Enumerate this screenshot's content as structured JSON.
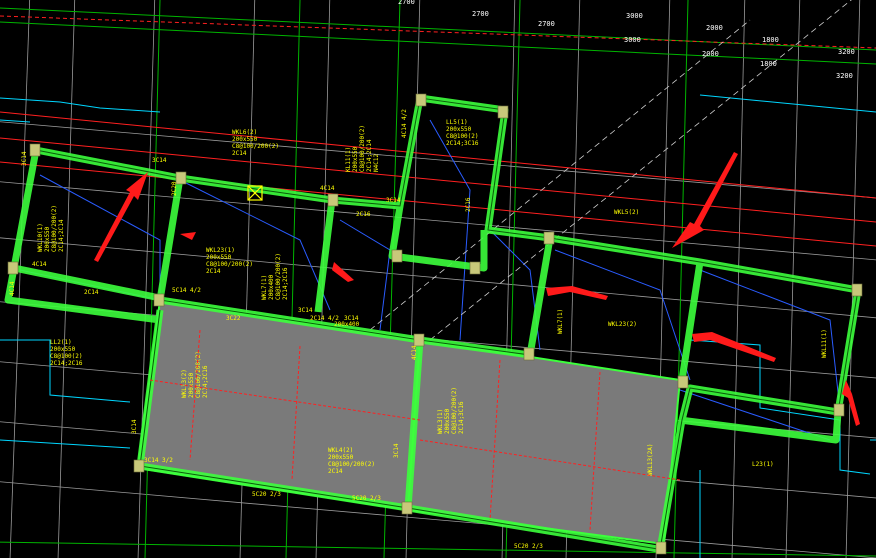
{
  "colors": {
    "background": "#000000",
    "beam_outline": "#3cff3c",
    "beam_fill": "#5fe35f",
    "column": "#c8c87a",
    "slab_fill": "#7a7a7a",
    "grid_white": "#d0d0d0",
    "grid_green": "#00b000",
    "axis_red": "#ff2020",
    "cyan": "#00d6ff",
    "blue": "#2060ff",
    "text_yellow": "#ffff00",
    "arrow_red": "#ff1a1a"
  },
  "dimensions": {
    "top_row_1": [
      "2700",
      "2700",
      "3000",
      "2000",
      "1800",
      "3200"
    ],
    "top_row_2": [
      "2700",
      "3000",
      "2000",
      "1800",
      "3200"
    ]
  },
  "beam_labels": [
    {
      "id": "wkl6",
      "lines": [
        "WKL6(2)",
        "200x550",
        "C8@100/200(2)",
        "2C14"
      ]
    },
    {
      "id": "ll5",
      "lines": [
        "LL5(1)",
        "200x550",
        "C8@100(2)",
        "2C14;3C16"
      ]
    },
    {
      "id": "wkl10",
      "lines": [
        "WKL10(1)",
        "200x550",
        "C8@100/200(2)",
        "2C14;2C14"
      ]
    },
    {
      "id": "wkl23",
      "lines": [
        "WKL23(1)",
        "200x550",
        "C8@100/200(2)",
        "2C14"
      ]
    },
    {
      "id": "wkl7",
      "lines": [
        "WKL7(1)",
        "200x400",
        "C8@100/200(2)",
        "2C14;2C16"
      ]
    },
    {
      "id": "kl11",
      "lines": [
        "KL11(1)",
        "200x550",
        "C8@100/200(2)",
        "2C14;2C14",
        "N4C12"
      ]
    },
    {
      "id": "wkl13",
      "lines": [
        "WKL13(2)",
        "200x550",
        "C8@100/200(2)",
        "2C14;2C16"
      ]
    },
    {
      "id": "wkl3",
      "lines": [
        "WKL3(1)",
        "200x550",
        "C8@100/200(2)",
        "2C14;3C16"
      ]
    },
    {
      "id": "wkl4",
      "lines": [
        "WKL4(2)",
        "200x550",
        "C8@100/200(2)",
        "2C14"
      ]
    },
    {
      "id": "ll2",
      "lines": [
        "LL2(1)",
        "200x550",
        "C8@100(2)",
        "2C14;2C16"
      ]
    },
    {
      "id": "wkl23b",
      "lines": [
        "WKL23(2)"
      ]
    },
    {
      "id": "wkl11",
      "lines": [
        "WKL11(1)"
      ]
    },
    {
      "id": "wkl13b",
      "lines": [
        "WKL13(2A)"
      ]
    },
    {
      "id": "wkl7b",
      "lines": [
        "WKL7(1)"
      ]
    },
    {
      "id": "wkl5",
      "lines": [
        "WKL5(2)"
      ]
    },
    {
      "id": "l23",
      "lines": [
        "L23(1)"
      ]
    }
  ],
  "small_labels": {
    "c14_a": "3C14",
    "c14_b": "4C14",
    "c14_c": "3C14",
    "c14_d": "2C16",
    "c14_e": "3C14",
    "c14_f": "4C14",
    "c14_g": "2C14",
    "c14_h": "5C14 4/2",
    "c14_i": "3C22",
    "c14_j": "3C14",
    "c14_k": "2C14 4/2",
    "c14_l": "4C14 4/2",
    "c14_m": "3C14 3/2",
    "c14_n": "5C20 2/3",
    "c14_o": "5C20 2/3",
    "c14_p": "5C20 2/3",
    "c14_q": "3C14",
    "c14_r": "2C16",
    "c14_s": "3C14",
    "c14_t": "4C14",
    "c14_u": "200x400",
    "c14_v": "4C14",
    "c14_w": "3C14",
    "c14_x": "2C20"
  }
}
